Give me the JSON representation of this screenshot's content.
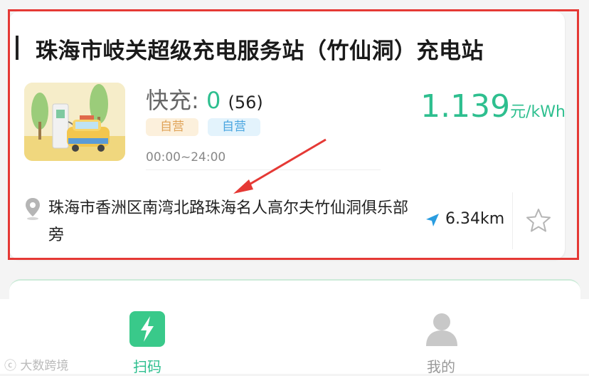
{
  "station": {
    "name": "珠海市岐关超级充电服务站（竹仙洞）充电站",
    "charge_type_label": "快充:",
    "available": "0",
    "total": "(56)",
    "tags": [
      "自营",
      "自营"
    ],
    "hours": "00:00~24:00",
    "price_amount": "1.139",
    "price_unit": "元/kWh",
    "address": "珠海市香洲区南湾北路珠海名人高尔夫竹仙洞俱乐部旁",
    "distance": "6.34km"
  },
  "tabbar": {
    "scan_label": "扫码",
    "me_label": "我的"
  },
  "watermark": "大数跨境",
  "colors": {
    "accent": "#2ebf8f",
    "highlight": "#e53935",
    "tag_orange": "#e0a45a",
    "tag_blue": "#4ba6e0"
  }
}
